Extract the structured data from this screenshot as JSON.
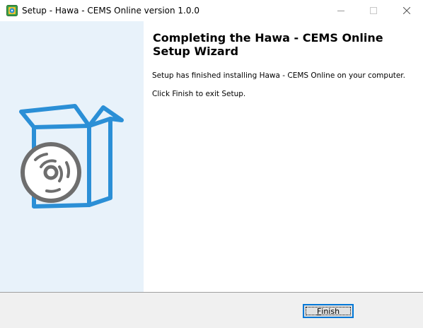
{
  "window": {
    "title": "Setup - Hawa - CEMS Online version 1.0.0",
    "app_icon": "setup-app-icon",
    "controls": {
      "minimize_icon": "minimize-icon",
      "maximize_icon": "maximize-icon",
      "close_icon": "close-icon"
    }
  },
  "sidebar": {
    "illustration_icon": "box-with-disc-icon",
    "background_color": "#e8f2fa",
    "accent_color": "#2b8fd6",
    "disc_color": "#6e6e6e"
  },
  "content": {
    "heading": "Completing the Hawa - CEMS Online Setup Wizard",
    "message": "Setup has finished installing Hawa - CEMS Online on your computer.",
    "instruction": "Click Finish to exit Setup."
  },
  "footer": {
    "finish_label_mnemonic": "F",
    "finish_label_rest": "inish",
    "button_border_color": "#0078d7"
  }
}
